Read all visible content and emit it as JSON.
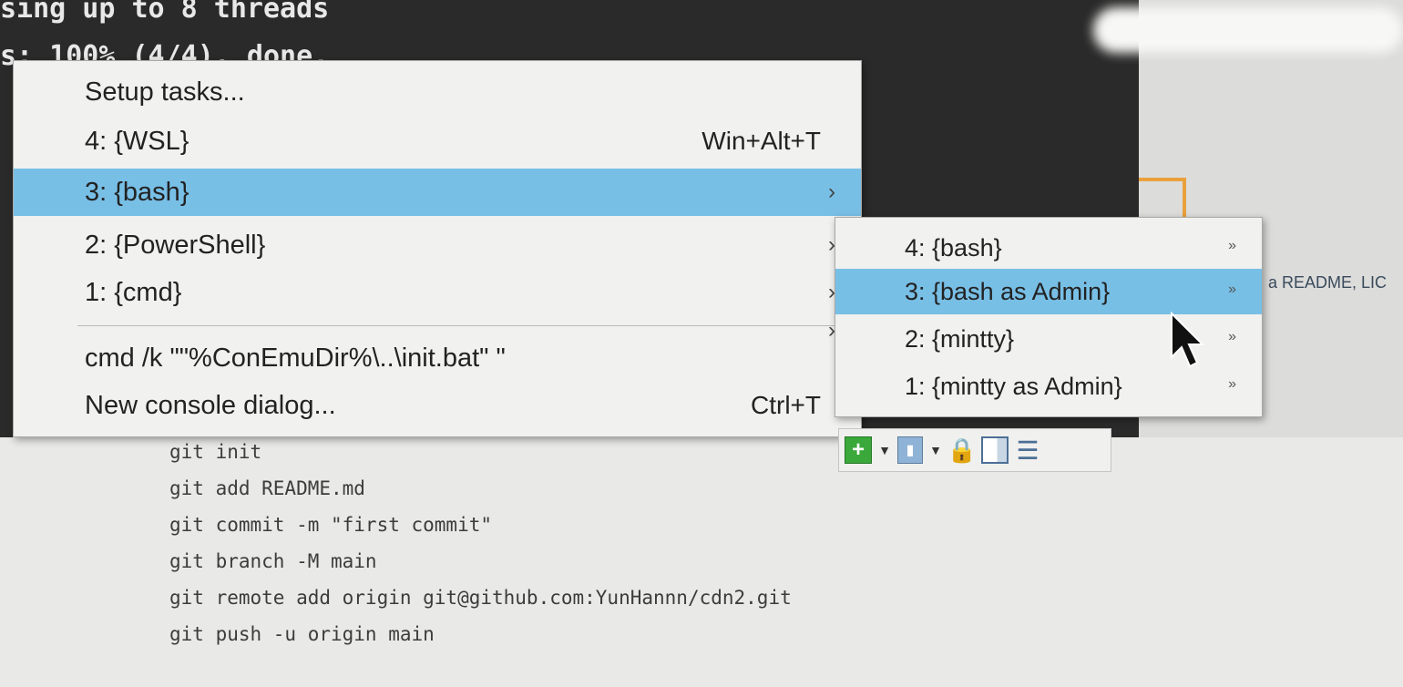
{
  "terminal": {
    "line1": "sing up to 8 threads",
    "line2": "s: 100% (4/4), done."
  },
  "right_page": {
    "fragment": "a README, LIC"
  },
  "code_lines": [
    "git init",
    "git add README.md",
    "git commit -m \"first commit\"",
    "git branch -M main",
    "git remote add origin git@github.com:YunHannn/cdn2.git",
    "git push -u origin main"
  ],
  "menu": {
    "items": [
      {
        "label": "Setup tasks...",
        "shortcut": "",
        "has_submenu": false
      },
      {
        "label": "4: {WSL}",
        "shortcut": "Win+Alt+T",
        "has_submenu": false
      },
      {
        "label": "3: {bash}",
        "shortcut": "",
        "has_submenu": true,
        "arrow": "›"
      },
      {
        "label": "2: {PowerShell}",
        "shortcut": "",
        "has_submenu": true,
        "arrow": "›"
      },
      {
        "label": "1: {cmd}",
        "shortcut": "",
        "has_submenu": true,
        "arrow": "›"
      },
      {
        "label": "cmd /k \"\"%ConEmuDir%\\..\\init.bat\" \"",
        "shortcut": "",
        "has_submenu": false
      },
      {
        "label": "New console dialog...",
        "shortcut": "Ctrl+T",
        "has_submenu": false
      }
    ],
    "extra_arrow": "›",
    "selected_index": 2
  },
  "submenu": {
    "items": [
      {
        "label": "4: {bash}",
        "arrow": "»"
      },
      {
        "label": "3: {bash as Admin}",
        "arrow": "»"
      },
      {
        "label": "2: {mintty}",
        "arrow": "»"
      },
      {
        "label": "1: {mintty as Admin}",
        "arrow": "»"
      }
    ],
    "selected_index": 1
  },
  "toolbar": {
    "icons": [
      "new-console-icon",
      "dropdown-icon",
      "terminal-icon",
      "dropdown-icon",
      "lock-icon",
      "split-view-icon",
      "menu-icon"
    ]
  },
  "colors": {
    "selection": "#78bfe6",
    "menu_bg": "#f1f1ef",
    "terminal_bg": "#2a2a2a"
  }
}
